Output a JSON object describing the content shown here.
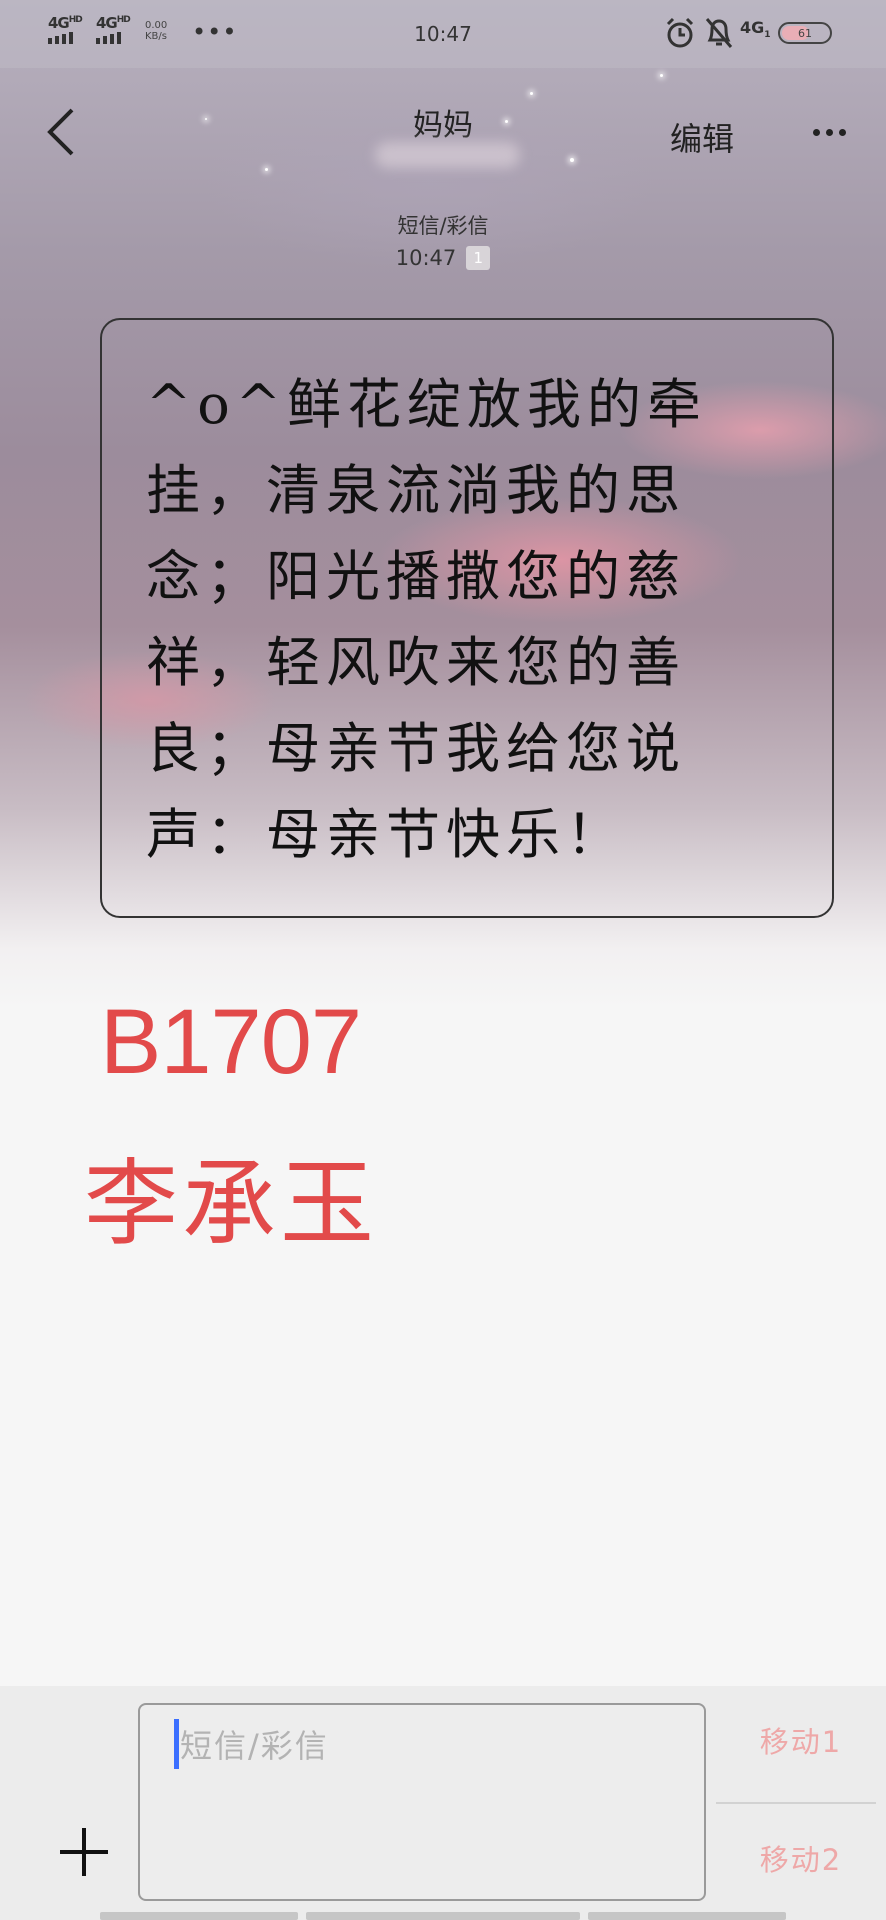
{
  "status_bar": {
    "network1": "4G",
    "network1_sup": "HD",
    "network2": "4G",
    "network2_sup": "HD",
    "speed_value": "0.00",
    "speed_unit": "KB/s",
    "overflow": "•••",
    "time": "10:47",
    "network3": "4G",
    "network3_sub": "1",
    "battery": "61",
    "battery_level_percent": 61,
    "icons": [
      "signal-bars-icon",
      "signal-bars-icon",
      "alarm-icon",
      "mute-icon",
      "battery-icon"
    ]
  },
  "header": {
    "contact_name": "妈妈",
    "edit_label": "编辑",
    "more_icon": "more-horizontal-icon",
    "back_icon": "chevron-left-icon"
  },
  "message_meta": {
    "type": "短信/彩信",
    "time": "10:47",
    "sim_badge": "1"
  },
  "message": {
    "text": "^o^鲜花绽放我的牵挂，清泉流淌我的思念；阳光播撒您的慈祥，轻风吹来您的善良；母亲节我给您说声：母亲节快乐！"
  },
  "overlay": {
    "code": "B1707",
    "name": "李承玉",
    "color": "#e24a4a"
  },
  "composer": {
    "placeholder": "短信/彩信",
    "send_sim1_label": "移动1",
    "send_sim2_label": "移动2",
    "add_icon": "plus-icon",
    "send_color": "#eea8a8"
  }
}
